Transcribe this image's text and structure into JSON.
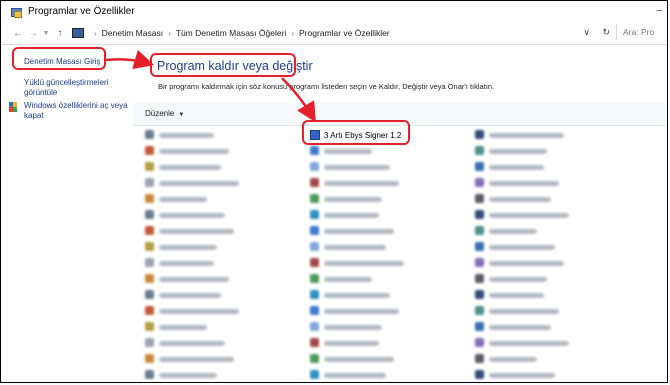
{
  "window": {
    "title": "Programlar ve Özellikler"
  },
  "address_bar": {
    "breadcrumbs": [
      "Denetim Masası",
      "Tüm Denetim Masası Öğeleri",
      "Programlar ve Özellikler"
    ],
    "search_placeholder": "Ara: Pro"
  },
  "sidebar": {
    "home_link": "Denetim Masası Giriş",
    "updates_link": "Yüklü güncelleştirmeleri görüntüle",
    "features_link": "Windows özelliklerini aç veya kapat"
  },
  "main": {
    "title": "Program kaldır veya değiştir",
    "description": "Bir programı kaldırmak için söz konusu programı listeden seçin ve Kaldır, Değiştir veya Onar'ı tıklatın.",
    "organize_label": "Düzenle",
    "highlighted_program": "3 Artı Ebys Signer 1.2"
  },
  "colors": {
    "callout": "#e5202a",
    "link": "#1a3f8c",
    "title": "#1e3d8f"
  },
  "icons": [
    "app-icon",
    "back-arrow-icon",
    "forward-arrow-icon",
    "up-arrow-icon",
    "computer-icon",
    "shield-icon",
    "refresh-icon",
    "chevron-down-icon"
  ]
}
